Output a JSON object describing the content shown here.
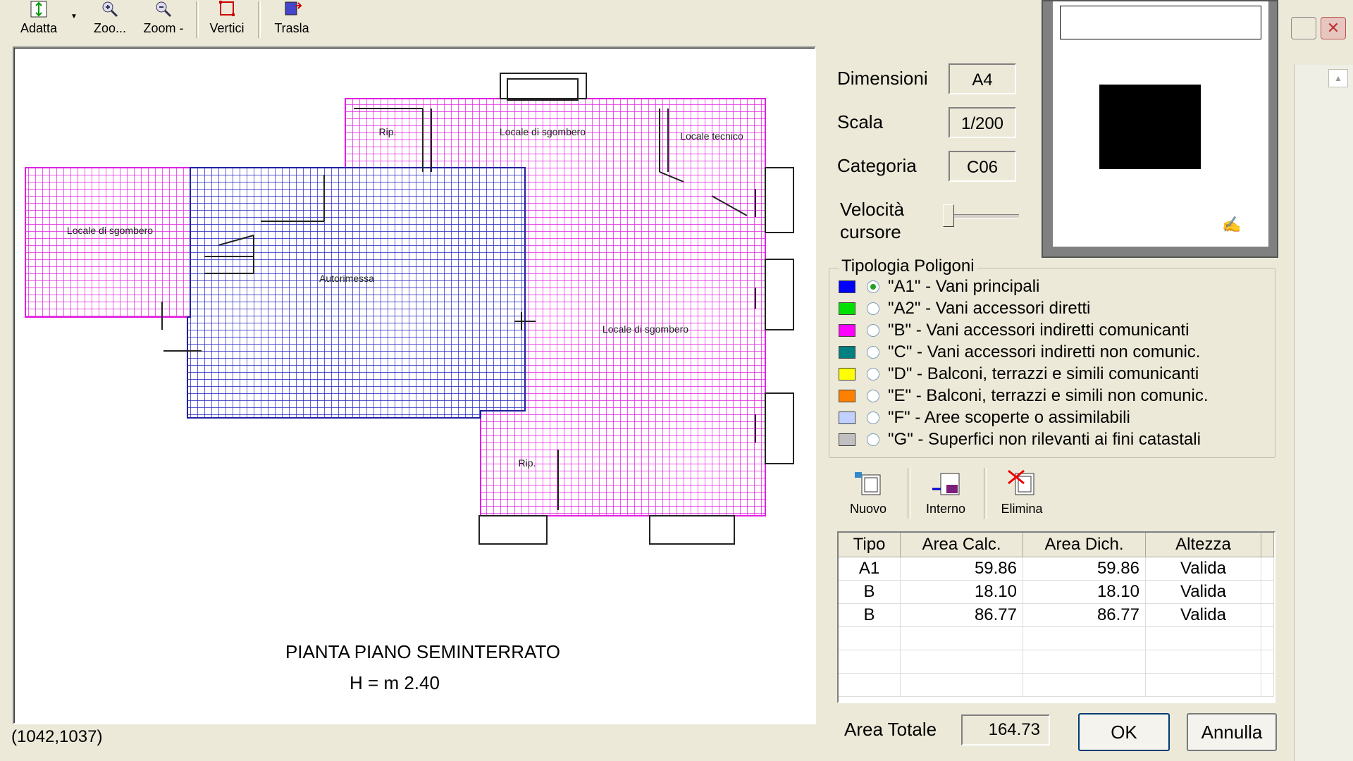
{
  "toolbar": {
    "buttons": [
      {
        "label": "Adatta"
      },
      {
        "label": "Zoo..."
      },
      {
        "label": "Zoom -"
      },
      {
        "label": "Vertici"
      },
      {
        "label": "Trasla"
      }
    ]
  },
  "plan": {
    "title": "PIANTA PIANO SEMINTERRATO",
    "height_label": "H = m 2.40",
    "rooms": {
      "rip": "Rip.",
      "locale_sgombero_top": "Locale di sgombero",
      "locale_tecnico": "Locale tecnico",
      "locale_sgombero_left": "Locale di sgombero",
      "autorimessa": "Autorimessa",
      "locale_sgombero_right": "Locale di sgombero",
      "rip_bottom": "Rip."
    }
  },
  "status": {
    "coords": "(1042,1037)"
  },
  "fields": {
    "dimensioni_label": "Dimensioni",
    "dimensioni_value": "A4",
    "scala_label": "Scala",
    "scala_value": "1/200",
    "categoria_label": "Categoria",
    "categoria_value": "C06",
    "velocita_label_1": "Velocità",
    "velocita_label_2": "cursore"
  },
  "tipologia": {
    "title": "Tipologia Poligoni",
    "items": [
      {
        "label": "\"A1\" - Vani principali",
        "color": "#0000ff",
        "selected": true
      },
      {
        "label": "\"A2\" - Vani accessori diretti",
        "color": "#00e000",
        "selected": false
      },
      {
        "label": "\"B\" - Vani accessori indiretti comunicanti",
        "color": "#ff00ff",
        "selected": false
      },
      {
        "label": "\"C\" - Vani accessori indiretti non comunic.",
        "color": "#008080",
        "selected": false
      },
      {
        "label": "\"D\" - Balconi, terrazzi e simili comunicanti",
        "color": "#ffff00",
        "selected": false
      },
      {
        "label": "\"E\" - Balconi, terrazzi e simili non comunic.",
        "color": "#ff8000",
        "selected": false
      },
      {
        "label": "\"F\" - Aree scoperte o assimilabili",
        "color": "#c0d0ff",
        "selected": false
      },
      {
        "label": "\"G\" - Superfici non rilevanti ai fini catastali",
        "color": "#c0c0c0",
        "selected": false
      }
    ]
  },
  "actions": {
    "nuovo": "Nuovo",
    "interno": "Interno",
    "elimina": "Elimina"
  },
  "table": {
    "headers": [
      "Tipo",
      "Area Calc.",
      "Area Dich.",
      "Altezza"
    ],
    "rows": [
      [
        "A1",
        "59.86",
        "59.86",
        "Valida"
      ],
      [
        "B",
        "18.10",
        "18.10",
        "Valida"
      ],
      [
        "B",
        "86.77",
        "86.77",
        "Valida"
      ]
    ]
  },
  "footer": {
    "total_label": "Area Totale",
    "total_value": "164.73",
    "ok": "OK",
    "annulla": "Annulla"
  }
}
